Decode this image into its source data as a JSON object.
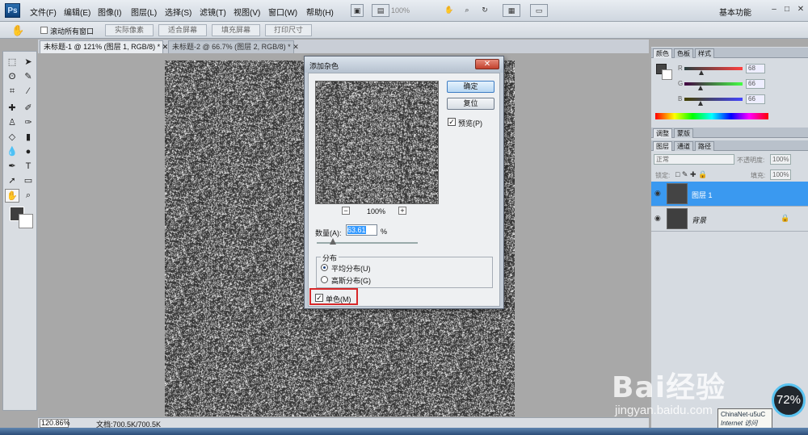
{
  "menubar": {
    "logo": "Ps",
    "items": [
      "文件(F)",
      "编辑(E)",
      "图像(I)",
      "图层(L)",
      "选择(S)",
      "滤镜(T)",
      "视图(V)",
      "窗口(W)",
      "帮助(H)"
    ],
    "zoom": "100%",
    "workspace": "基本功能"
  },
  "options": {
    "scroll_all": "滚动所有窗口",
    "buttons": [
      "实际像素",
      "适合屏幕",
      "填充屏幕",
      "打印尺寸"
    ]
  },
  "tabs": [
    "未标题-1 @ 121% (图层 1, RGB/8) *",
    "未标题-2 @ 66.7% (图层 2, RGB/8) *"
  ],
  "dialog": {
    "title": "添加杂色",
    "ok": "确定",
    "reset": "复位",
    "preview_label": "预览(P)",
    "preview_zoom": "100%",
    "amount_label": "数量(A):",
    "amount_value": "63.61",
    "amount_unit": "%",
    "amount_level": 0.16,
    "distribution_label": "分布",
    "uniform": "平均分布(U)",
    "gaussian": "高斯分布(G)",
    "monochromatic": "单色(M)"
  },
  "color_panel": {
    "tabs": [
      "颜色",
      "色板",
      "样式"
    ],
    "values": [
      "68",
      "66",
      "66"
    ],
    "channels": [
      "R",
      "G",
      "B"
    ]
  },
  "adjust_tabs": [
    "调整",
    "蒙版"
  ],
  "layers_panel": {
    "tabs": [
      "图层",
      "通道",
      "路径"
    ],
    "blend_mode": "正常",
    "opacity_label": "不透明度:",
    "opacity": "100%",
    "lock_label": "锁定:",
    "fill_label": "填充:",
    "fill": "100%",
    "layers": [
      "图层 1",
      "背景"
    ]
  },
  "status": {
    "zoom": "120.86%",
    "doc": "文档:700.5K/700.5K"
  },
  "watermark": {
    "logo": "Bai经验",
    "url": "jingyan.baidu.com"
  },
  "tooltip": {
    "line1": "ChinaNet-u5uC",
    "line2": "Internet 访问"
  },
  "perf": "72%"
}
